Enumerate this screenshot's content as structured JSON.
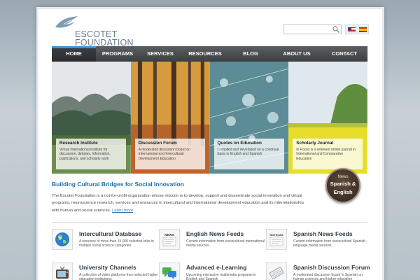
{
  "logo": {
    "line1": "ESCOTET",
    "line2": "FOUNDATION"
  },
  "search": {
    "placeholder": ""
  },
  "nav": [
    "HOME",
    "PROGRAMS",
    "SERVICES",
    "RESOURCES",
    "BLOG",
    "ABOUT US",
    "CONTACT"
  ],
  "hero": [
    {
      "title": "Research Institute",
      "text": "Virtual international institute for discussion, debates, information, publications, and scholarly work"
    },
    {
      "title": "Discussion Forum",
      "text": "A moderated discussion board on International and Intercultural Development Education"
    },
    {
      "title": "Quotes on Education",
      "text": "Compiled and developed on a continual basis in English and Spanish"
    },
    {
      "title": "Scholarly Journal",
      "text": "In Focus is a refereed online journal in International and Comparative Education"
    }
  ],
  "tagline": "Building Cultural Bridges for Social Innovation",
  "intro": {
    "text": "The Escotet Foundation is a not-for-profit-organization whose mission is to develop, support and disseminate social innovation and virtual programs, neuroscience research, services and resources in intercultural and international development education and its interrelationship with human and social sciences.",
    "link": "Learn more"
  },
  "badge": {
    "top": "News",
    "line1": "Spanish &",
    "line2": "English"
  },
  "features": [
    {
      "title": "Intercultural Database",
      "text": "A resource of more than 15,000 selected links in multiple social science categories.",
      "icon": "globe-icon"
    },
    {
      "title": "English News Feeds",
      "text": "Current information from sociocultural international media sources.",
      "icon": "news-icon",
      "icon_label": "NEWS"
    },
    {
      "title": "Spanish News Feeds",
      "text": "Current information from sociocultural Spanish-language media sources.",
      "icon": "noticias-icon",
      "icon_label": "NOTICIAS"
    },
    {
      "title": "University Channels",
      "text": "A collection of video platforms from selected higher education institutions",
      "icon": "tv-icon"
    },
    {
      "title": "Advanced e-Learning",
      "text": "Upcoming interactive multimedia programs in English and Spanish",
      "icon": "chat-icon"
    },
    {
      "title": "Spanish Discussion Forum",
      "text": "A moderated discussion board in Spanish on human sciences and higher education",
      "icon": "keyboard-icon"
    }
  ],
  "colors": {
    "accent": "#3d93d6",
    "link": "#1f6fa8",
    "nav": "#3b3e41"
  }
}
